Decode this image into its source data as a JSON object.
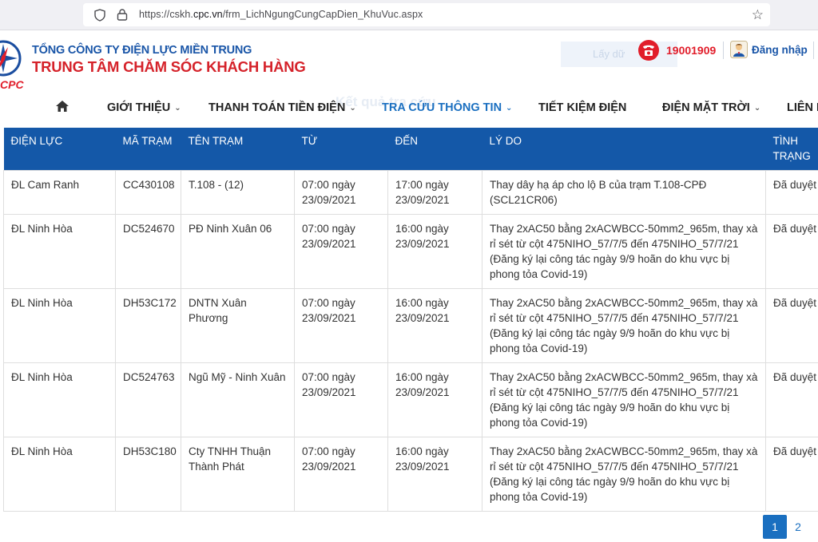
{
  "browser": {
    "url_prefix": "https://cskh.",
    "url_domain": "cpc.vn",
    "url_path": "/frm_LichNgungCungCapDien_KhuVuc.aspx"
  },
  "header": {
    "logo_text_a": "",
    "logo_text_b": "CPC",
    "org_name": "TỔNG CÔNG TY ĐIỆN LỰC MIỀN TRUNG",
    "center_name": "TRUNG TÂM CHĂM SÓC KHÁCH HÀNG",
    "hidden_button": "Lấy dữ",
    "hotline": "19001909",
    "login": "Đăng nhập",
    "ghost_title": "Kết quả tra cứu"
  },
  "nav": {
    "items": [
      {
        "label": "GIỚI THIỆU",
        "caret": "⌄"
      },
      {
        "label": "THANH TOÁN TIỀN ĐIỆN",
        "caret": "⌄"
      },
      {
        "label": "TRA CỨU THÔNG TIN",
        "caret": "⌄"
      },
      {
        "label": "TIẾT KIỆM ĐIỆN",
        "caret": ""
      },
      {
        "label": "ĐIỆN MẶT TRỜI",
        "caret": "⌄"
      },
      {
        "label": "LIÊN H",
        "caret": ""
      }
    ]
  },
  "table": {
    "headers": [
      "ĐIỆN LỰC",
      "MÃ TRẠM",
      "TÊN TRẠM",
      "TỪ",
      "ĐẾN",
      "LÝ DO",
      "TÌNH TRẠNG"
    ],
    "rows": [
      [
        "ĐL Cam Ranh",
        "CC430108",
        "T.108 - (12)",
        "07:00 ngày 23/09/2021",
        "17:00 ngày 23/09/2021",
        "Thay dây hạ áp cho lộ B của trạm T.108-CPĐ (SCL21CR06)",
        "Đã duyệt"
      ],
      [
        "ĐL Ninh Hòa",
        "DC524670",
        "PĐ Ninh Xuân 06",
        "07:00 ngày 23/09/2021",
        "16:00 ngày 23/09/2021",
        "Thay 2xAC50 bằng 2xACWBCC-50mm2_965m, thay xà rỉ sét từ cột 475NIHO_57/7/5 đến 475NIHO_57/7/21 (Đăng ký lại công tác ngày 9/9 hoãn do khu vực bị phong tỏa Covid-19)",
        "Đã duyệt"
      ],
      [
        "ĐL Ninh Hòa",
        "DH53C172",
        "DNTN Xuân Phương",
        "07:00 ngày 23/09/2021",
        "16:00 ngày 23/09/2021",
        "Thay 2xAC50 bằng 2xACWBCC-50mm2_965m, thay xà rỉ sét từ cột 475NIHO_57/7/5 đến 475NIHO_57/7/21 (Đăng ký lại công tác ngày 9/9 hoãn do khu vực bị phong tỏa Covid-19)",
        "Đã duyệt"
      ],
      [
        "ĐL Ninh Hòa",
        "DC524763",
        "Ngũ Mỹ - Ninh Xuân",
        "07:00 ngày 23/09/2021",
        "16:00 ngày 23/09/2021",
        "Thay 2xAC50 bằng 2xACWBCC-50mm2_965m, thay xà rỉ sét từ cột 475NIHO_57/7/5 đến 475NIHO_57/7/21 (Đăng ký lại công tác ngày 9/9 hoãn do khu vực bị phong tỏa Covid-19)",
        "Đã duyệt"
      ],
      [
        "ĐL Ninh Hòa",
        "DH53C180",
        "Cty TNHH Thuận Thành Phát",
        "07:00 ngày 23/09/2021",
        "16:00 ngày 23/09/2021",
        "Thay 2xAC50 bằng 2xACWBCC-50mm2_965m, thay xà rỉ sét từ cột 475NIHO_57/7/5 đến 475NIHO_57/7/21 (Đăng ký lại công tác ngày 9/9 hoãn do khu vực bị phong tỏa Covid-19)",
        "Đã duyệt"
      ]
    ]
  },
  "pagination": {
    "pages": [
      "1",
      "2"
    ],
    "active": "1"
  },
  "colors": {
    "brand_blue": "#1458a8",
    "brand_red": "#e11d2a",
    "link_blue": "#1a6fc0"
  }
}
